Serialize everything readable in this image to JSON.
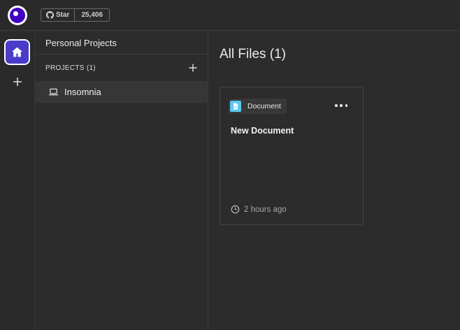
{
  "topbar": {
    "github": {
      "star_label": "Star",
      "count": "25,406"
    }
  },
  "sidebar": {
    "org_title": "Personal Projects",
    "projects_header": "PROJECTS (1)",
    "projects": [
      {
        "label": "Insomnia"
      }
    ]
  },
  "main": {
    "title": "All Files (1)",
    "files": [
      {
        "type_label": "Document",
        "title": "New Document",
        "modified": "2 hours ago"
      }
    ]
  },
  "colors": {
    "accent": "#4000bf",
    "home_active": "#4a3cc8",
    "document_badge": "#5ac8f0"
  }
}
